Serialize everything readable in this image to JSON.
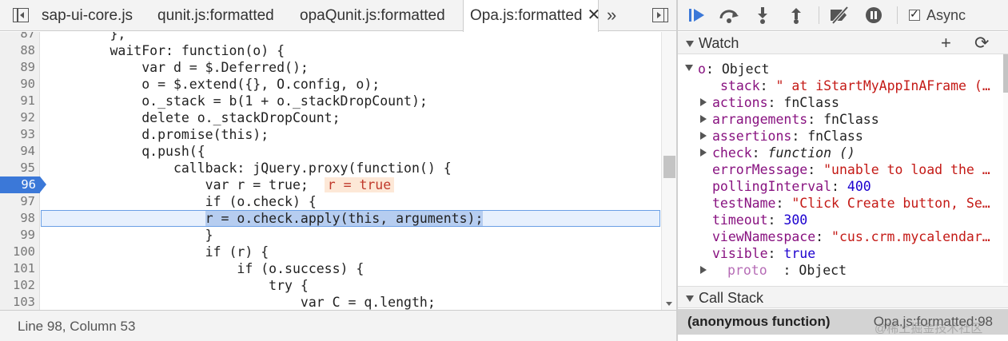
{
  "tabs": {
    "items": [
      {
        "label": "sap-ui-core.js"
      },
      {
        "label": "qunit.js:formatted"
      },
      {
        "label": "opaQunit.js:formatted"
      },
      {
        "label": "Opa.js:formatted",
        "active": true
      }
    ],
    "close_glyph": "✕",
    "overflow_glyph": "»"
  },
  "code": {
    "lines": [
      {
        "num": "87",
        "text": "        },"
      },
      {
        "num": "88",
        "text": "        waitFor: function(o) {"
      },
      {
        "num": "89",
        "text": "            var d = $.Deferred();"
      },
      {
        "num": "90",
        "text": "            o = $.extend({}, O.config, o);"
      },
      {
        "num": "91",
        "text": "            o._stack = b(1 + o._stackDropCount);"
      },
      {
        "num": "92",
        "text": "            delete o._stackDropCount;"
      },
      {
        "num": "93",
        "text": "            d.promise(this);"
      },
      {
        "num": "94",
        "text": "            q.push({"
      },
      {
        "num": "95",
        "text": "                callback: jQuery.proxy(function() {"
      },
      {
        "num": "96",
        "text": "                    var r = true;",
        "breakpoint": true,
        "inline_value": "r = true"
      },
      {
        "num": "97",
        "text": "                    if (o.check) {"
      },
      {
        "num": "98",
        "text_pre": "                    ",
        "text_sel": "r = o.check.apply(this, arguments);",
        "current": true
      },
      {
        "num": "99",
        "text": "                    }"
      },
      {
        "num": "100",
        "text": "                    if (r) {"
      },
      {
        "num": "101",
        "text": "                        if (o.success) {"
      },
      {
        "num": "102",
        "text": "                            try {"
      },
      {
        "num": "103",
        "text": "                                var C = q.length;"
      }
    ]
  },
  "status": {
    "position": "Line 98, Column 53"
  },
  "debugger": {
    "async_label": "Async",
    "async_checked": true
  },
  "watch": {
    "title": "Watch",
    "add_glyph": "+",
    "refresh_glyph": "⟳",
    "root_name": "o",
    "root_type": "Object",
    "props": [
      {
        "key": "stack",
        "value": "\" at iStartMyAppInAFrame (…",
        "kind": "str",
        "expandable": false
      },
      {
        "key": "actions",
        "value": "fnClass",
        "kind": "plain",
        "expandable": true
      },
      {
        "key": "arrangements",
        "value": "fnClass",
        "kind": "plain",
        "expandable": true
      },
      {
        "key": "assertions",
        "value": "fnClass",
        "kind": "plain",
        "expandable": true
      },
      {
        "key": "check",
        "value": "function ()",
        "kind": "fn",
        "expandable": true
      },
      {
        "key": "errorMessage",
        "value": "\"unable to load the …",
        "kind": "str",
        "expandable": false
      },
      {
        "key": "pollingInterval",
        "value": "400",
        "kind": "num",
        "expandable": false
      },
      {
        "key": "testName",
        "value": "\"Click Create button, Se…",
        "kind": "str",
        "expandable": false
      },
      {
        "key": "timeout",
        "value": "300",
        "kind": "num",
        "expandable": false
      },
      {
        "key": "viewNamespace",
        "value": "\"cus.crm.mycalendar…",
        "kind": "str",
        "expandable": false
      },
      {
        "key": "visible",
        "value": "true",
        "kind": "bool",
        "expandable": false
      },
      {
        "key": "__proto__",
        "display_key": "proto",
        "value": "Object",
        "kind": "plain",
        "expandable": true,
        "dim": true
      }
    ]
  },
  "call_stack": {
    "title": "Call Stack",
    "frames": [
      {
        "name": "(anonymous function)",
        "location": "Opa.js:formatted:98"
      }
    ]
  },
  "watermark": "@稀土掘金技术社区",
  "colors": {
    "breakpoint": "#3b78d8",
    "current_line_bg": "#e7f0fd",
    "keyword": "#aa0d91",
    "string": "#c41a16"
  }
}
